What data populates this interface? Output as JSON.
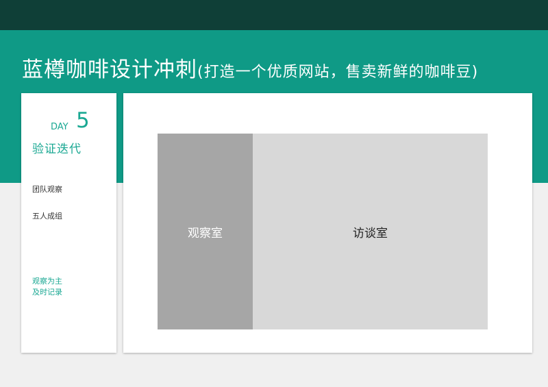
{
  "header": {
    "title": "蓝樽咖啡设计冲刺",
    "subtitle": "(打造一个优质网站，售卖新鲜的咖啡豆)"
  },
  "sidebar": {
    "day_label": "DAY",
    "day_number": "5",
    "phase": "验证迭代",
    "items": [
      "团队观察",
      "五人成组"
    ],
    "note": [
      "观察为主",
      "及时记录"
    ]
  },
  "diagram": {
    "observation_room": "观察室",
    "interview_room": "访谈室"
  },
  "colors": {
    "accent": "#1aa893",
    "band": "#0f9a86",
    "topbar": "#0f3f37",
    "observation_room": "#a6a6a6",
    "interview_room": "#d8d8d8"
  }
}
